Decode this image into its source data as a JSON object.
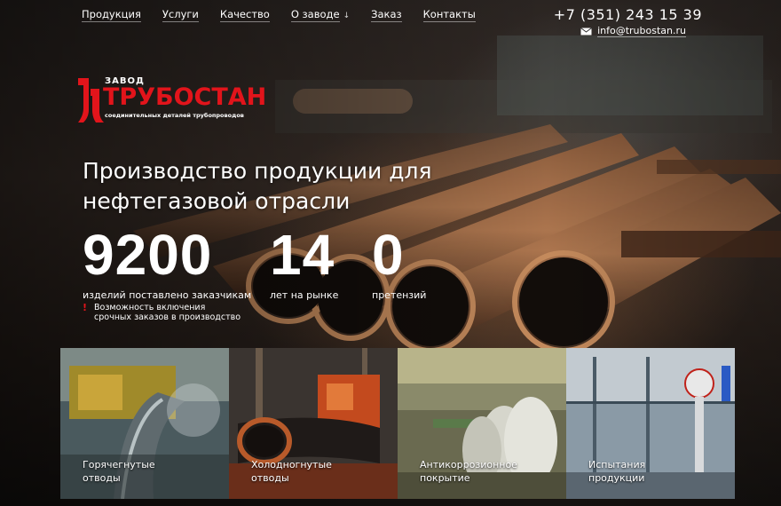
{
  "nav": {
    "items": [
      {
        "label": "Продукция"
      },
      {
        "label": "Услуги"
      },
      {
        "label": "Качество"
      },
      {
        "label": "О заводе"
      },
      {
        "label": "Заказ"
      },
      {
        "label": "Контакты"
      }
    ]
  },
  "contacts": {
    "phone": "+7 (351) 243 15 39",
    "email": "info@trubostan.ru"
  },
  "logo": {
    "small": "ЗАВОД",
    "name": "ТРУБОСТАН",
    "sub": "соединительных деталей трубопроводов"
  },
  "hero": {
    "headline": "Производство продукции для нефтегазовой отрасли",
    "stats": [
      {
        "value": "9200",
        "label": "изделий поставлено заказчикам"
      },
      {
        "value": "14",
        "label": "лет на рынке"
      },
      {
        "value": "0",
        "label": "претензий"
      }
    ],
    "note": {
      "mark": "!",
      "text": "Возможность включения срочных заказов в производство"
    }
  },
  "tiles": [
    {
      "caption": "Горячегнутые\nотводы"
    },
    {
      "caption": "Холодногнутые\nотводы"
    },
    {
      "caption": "Антикоррозионное\nпокрытие"
    },
    {
      "caption": "Испытания\nпродукции"
    }
  ],
  "colors": {
    "accent": "#e2141b"
  }
}
